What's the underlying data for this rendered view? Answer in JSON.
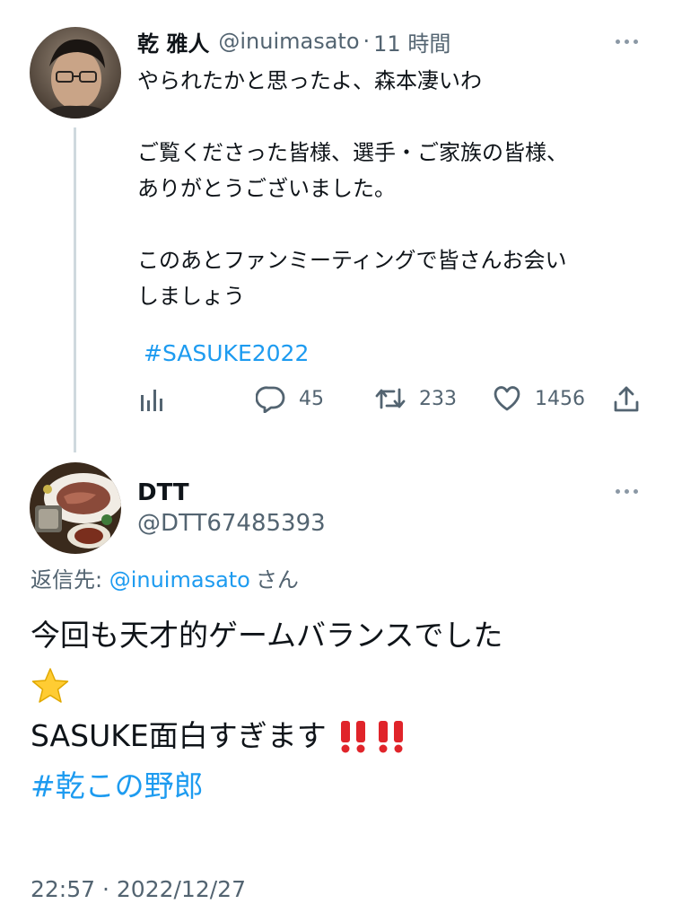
{
  "tweet1": {
    "display_name": "乾 雅人",
    "handle": "@inuimasato",
    "separator": "·",
    "time_ago": "11 時間",
    "lines": [
      "やられたかと思ったよ、森本凄いわ",
      "ご覧くださった皆様、選手・ご家族の皆様、",
      "ありがとうございました。",
      "このあとファンミーティングで皆さんお会い",
      "しましょう"
    ],
    "hashtag": "#SASUKE2022",
    "replies": "45",
    "retweets": "233",
    "likes": "1456"
  },
  "tweet2": {
    "display_name": "DTT",
    "handle": "@DTT67485393",
    "reply_to_label": "返信先: ",
    "reply_to_handle": "@inuimasato",
    "reply_to_suffix": "さん",
    "line1": "今回も天才的ゲームバランスでした",
    "line3": "SASUKE面白すぎます",
    "hashtag": "#乾この野郎",
    "timestamp": "22:57 · 2022/12/27"
  },
  "colors": {
    "link": "#1d9bf0",
    "muted": "#536471",
    "text": "#0f1419",
    "thread_line": "#cfd9de",
    "emoji_red": "#e0242a",
    "emoji_star": "#ffcc33"
  },
  "icons": [
    "more-icon",
    "analytics-icon",
    "reply-icon",
    "retweet-icon",
    "like-icon",
    "share-icon",
    "star-emoji-icon",
    "double-exclamation-icon"
  ]
}
